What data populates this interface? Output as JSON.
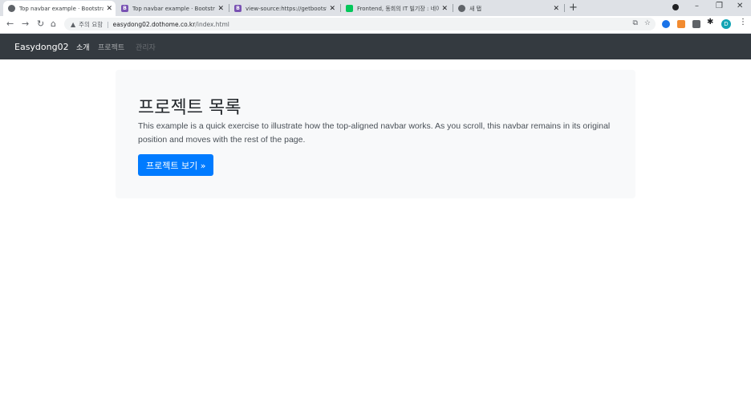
{
  "browser": {
    "tabs": [
      {
        "title": "Top navbar example · Bootstrap",
        "favicon": "globe-icon",
        "active": true
      },
      {
        "title": "Top navbar example · Bootstrap",
        "favicon": "bootstrap-icon",
        "active": false
      },
      {
        "title": "view-source:https://getbootstrap.c",
        "favicon": "bootstrap-icon",
        "active": false
      },
      {
        "title": "Frontend, 동희의 IT 빌기장 : 네이",
        "favicon": "naver-icon",
        "active": false
      },
      {
        "title": "새 탭",
        "favicon": "chrome-icon",
        "active": false
      }
    ],
    "close_glyph": "✕",
    "new_tab_glyph": "+",
    "address": {
      "security_label": "주의 요함",
      "host": "easydong02.dothome.co.kr",
      "path": "/index.html"
    }
  },
  "navbar": {
    "brand": "Easydong02",
    "links": [
      {
        "label": "소개",
        "state": "active"
      },
      {
        "label": "프로젝트",
        "state": "normal"
      },
      {
        "label": "관리자",
        "state": "disabled"
      }
    ]
  },
  "jumbotron": {
    "title": "프로젝트 목록",
    "lead": "This example is a quick exercise to illustrate how the top-aligned navbar works. As you scroll, this navbar remains in its original position and moves with the rest of the page.",
    "button_label": "프로젝트 보기 »"
  },
  "colors": {
    "navbar_bg": "#343a40",
    "jumbotron_bg": "#f8f9fa",
    "primary": "#007bff"
  }
}
